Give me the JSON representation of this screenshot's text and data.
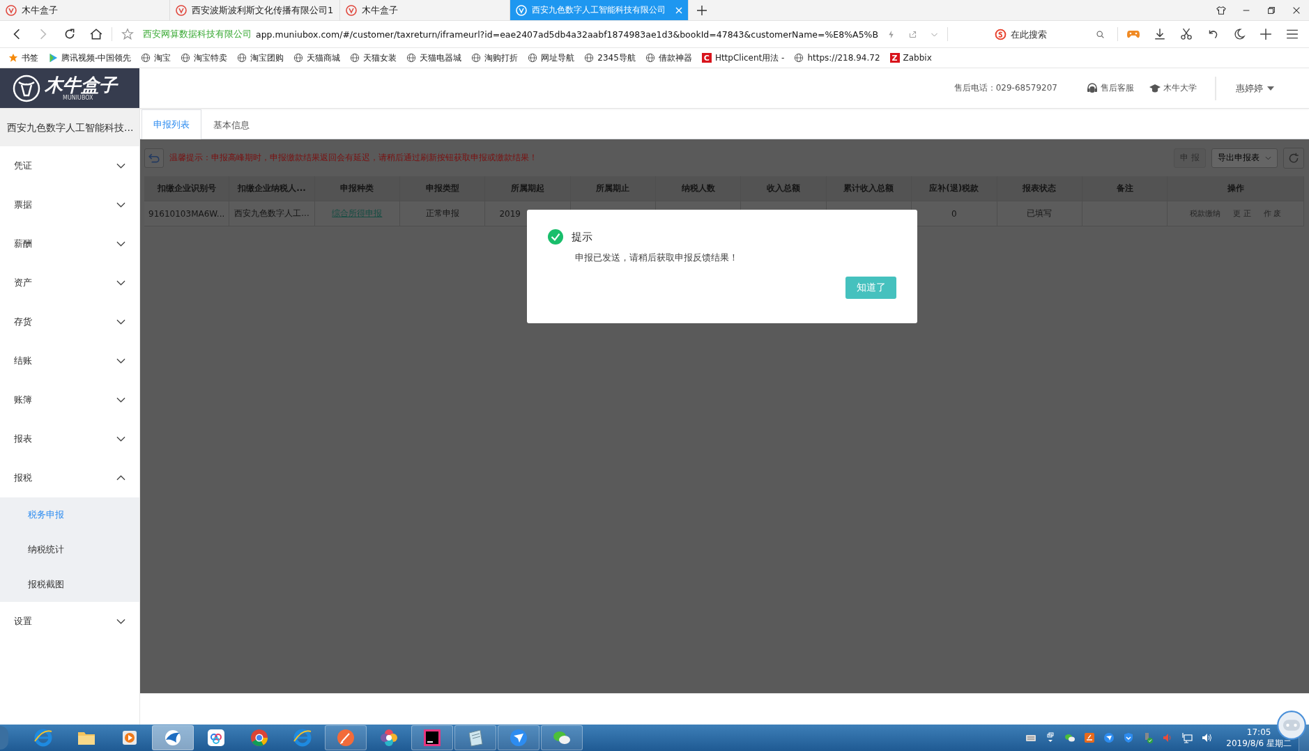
{
  "browser": {
    "tabs": [
      {
        "title": "木牛盒子",
        "selected": false
      },
      {
        "title": "西安波斯波利斯文化传播有限公司1",
        "selected": false
      },
      {
        "title": "木牛盒子",
        "selected": false
      },
      {
        "title": "西安九色数字人工智能科技有限公司",
        "selected": true
      }
    ],
    "address": {
      "site_name": "西安网算数据科技有限公司",
      "url": "app.muniubox.com/#/customer/taxreturn/iframeurl?id=eae2407ad5db4a32aabf1874983ae1d3&bookId=47843&customerName=%E8%A5%B"
    },
    "search": {
      "placeholder": "在此搜索"
    },
    "bookmarks": [
      {
        "kind": "star",
        "label": "书签"
      },
      {
        "kind": "video",
        "label": "腾讯视频-中国领先"
      },
      {
        "kind": "globe",
        "label": "淘宝"
      },
      {
        "kind": "globe",
        "label": "淘宝特卖"
      },
      {
        "kind": "globe",
        "label": "淘宝团购"
      },
      {
        "kind": "globe",
        "label": "天猫商城"
      },
      {
        "kind": "globe",
        "label": "天猫女装"
      },
      {
        "kind": "globe",
        "label": "天猫电器城"
      },
      {
        "kind": "globe",
        "label": "淘购打折"
      },
      {
        "kind": "globe",
        "label": "网址导航"
      },
      {
        "kind": "globe",
        "label": "2345导航"
      },
      {
        "kind": "globe",
        "label": "借款神器"
      },
      {
        "kind": "letter",
        "letter": "C",
        "label": "HttpClicent用法 -"
      },
      {
        "kind": "globe",
        "label": "https://218.94.72"
      },
      {
        "kind": "letter",
        "letter": "Z",
        "label": "Zabbix"
      }
    ]
  },
  "header": {
    "logo": {
      "name": "木牛盒子",
      "subtitle": "MUNIUBOX"
    },
    "phone": "售后电话：029-68579207",
    "links": [
      {
        "kind": "headset",
        "label": "售后客服"
      },
      {
        "kind": "cap",
        "label": "木牛大学"
      }
    ],
    "user": "惠婷婷"
  },
  "sidebar": {
    "company": "西安九色数字人工智能科技...",
    "items": [
      {
        "label": "凭证",
        "expanded": false
      },
      {
        "label": "票据",
        "expanded": false
      },
      {
        "label": "薪酬",
        "expanded": false
      },
      {
        "label": "资产",
        "expanded": false
      },
      {
        "label": "存货",
        "expanded": false
      },
      {
        "label": "结账",
        "expanded": false
      },
      {
        "label": "账簿",
        "expanded": false
      },
      {
        "label": "报表",
        "expanded": false
      },
      {
        "label": "报税",
        "expanded": true,
        "children": [
          {
            "label": "税务申报",
            "selected": true
          },
          {
            "label": "纳税统计",
            "selected": false
          },
          {
            "label": "报税截图",
            "selected": false
          }
        ]
      },
      {
        "label": "设置",
        "expanded": false
      }
    ]
  },
  "content_tabs": [
    {
      "label": "申报列表",
      "selected": true
    },
    {
      "label": "基本信息",
      "selected": false
    }
  ],
  "toolbar": {
    "notice": "温馨提示：申报高峰期时，申报缴款结果返回会有延迟，请稍后通过刷新按钮获取申报或缴款结果！",
    "buttons": [
      {
        "kind": "plain",
        "label": "申 报",
        "disabled": true
      },
      {
        "kind": "dropdown",
        "label": "导出申报表",
        "disabled": false
      }
    ]
  },
  "table": {
    "columns": [
      "扣缴企业识别号",
      "扣缴企业纳税人...",
      "申报种类",
      "申报类型",
      "所属期起",
      "所属期止",
      "纳税人数",
      "收入总额",
      "累计收入总额",
      "应补(退)税款",
      "报表状态",
      "备注",
      "操作"
    ],
    "rows": [
      {
        "cells": [
          {
            "kind": "text",
            "text": "91610103MA6W..."
          },
          {
            "kind": "text",
            "text": "西安九色数字人工..."
          },
          {
            "kind": "link",
            "text": "综合所得申报"
          },
          {
            "kind": "text",
            "text": "正常申报"
          },
          {
            "kind": "text",
            "text": "2019"
          },
          null,
          null,
          null,
          null,
          {
            "kind": "text",
            "text": "0"
          },
          {
            "kind": "text",
            "text": "已填写"
          },
          null,
          {
            "kind": "actions",
            "actions": [
              {
                "label": "税款缴纳",
                "disabled": true
              },
              {
                "label": "更 正",
                "disabled": true
              },
              {
                "label": "作 废",
                "disabled": true
              }
            ]
          }
        ]
      }
    ]
  },
  "dialog": {
    "title": "提示",
    "message": "申报已发送，请稍后获取申报反馈结果！",
    "button": "知道了"
  },
  "taskbar": {
    "apps": [
      {
        "kind": "ie",
        "open": false,
        "selected": false
      },
      {
        "kind": "folder",
        "open": false,
        "selected": false
      },
      {
        "kind": "media",
        "open": false,
        "selected": false
      },
      {
        "kind": "bird",
        "open": true,
        "selected": true
      },
      {
        "kind": "cloud",
        "open": false,
        "selected": false
      },
      {
        "kind": "chrome",
        "open": false,
        "selected": false
      },
      {
        "kind": "ie",
        "open": false,
        "selected": false
      },
      {
        "kind": "pen",
        "open": true,
        "selected": false
      },
      {
        "kind": "pinwheel",
        "open": false,
        "selected": false
      },
      {
        "kind": "ij",
        "open": true,
        "selected": false
      },
      {
        "kind": "notepad",
        "open": true,
        "selected": false
      },
      {
        "kind": "plane",
        "open": true,
        "selected": false
      },
      {
        "kind": "chat",
        "open": true,
        "selected": false
      }
    ],
    "tray": [
      {
        "kind": "keyboard"
      },
      {
        "kind": "windows"
      },
      {
        "kind": "chat"
      },
      {
        "kind": "orange"
      },
      {
        "kind": "plane"
      },
      {
        "kind": "shield"
      },
      {
        "kind": "usb"
      },
      {
        "kind": "speaker"
      },
      {
        "kind": "network"
      },
      {
        "kind": "volume"
      }
    ],
    "time": "17:05",
    "date": "2019/8/6 星期二"
  }
}
